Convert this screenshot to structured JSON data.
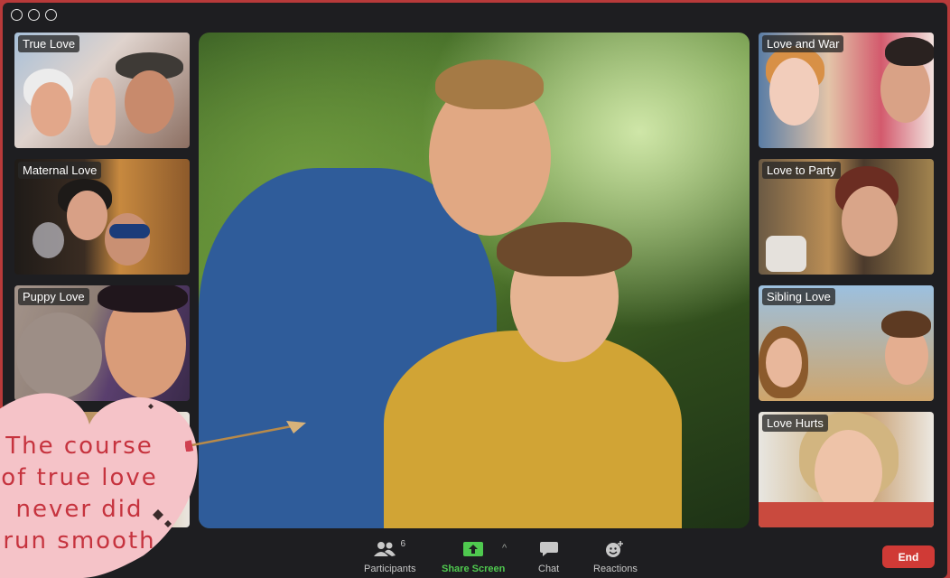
{
  "window": {
    "controls": [
      "close",
      "minimize",
      "zoom"
    ]
  },
  "tiles_left": [
    {
      "label": "True Love"
    },
    {
      "label": "Maternal Love"
    },
    {
      "label": "Puppy Love"
    }
  ],
  "tiles_right": [
    {
      "label": "Love and War"
    },
    {
      "label": "Love to Party"
    },
    {
      "label": "Sibling Love"
    },
    {
      "label": "Love Hurts"
    }
  ],
  "overlay": {
    "heart_lines": [
      "The course",
      "of true love",
      "never did",
      "run smooth"
    ],
    "heart_color": "#f5c3c8",
    "text_color": "#c6333e"
  },
  "toolbar": {
    "participants_label": "Participants",
    "participants_count": "6",
    "share_label": "Share Screen",
    "chat_label": "Chat",
    "reactions_label": "Reactions",
    "end_label": "End",
    "share_color": "#4fc94f",
    "end_color": "#d03a36"
  }
}
